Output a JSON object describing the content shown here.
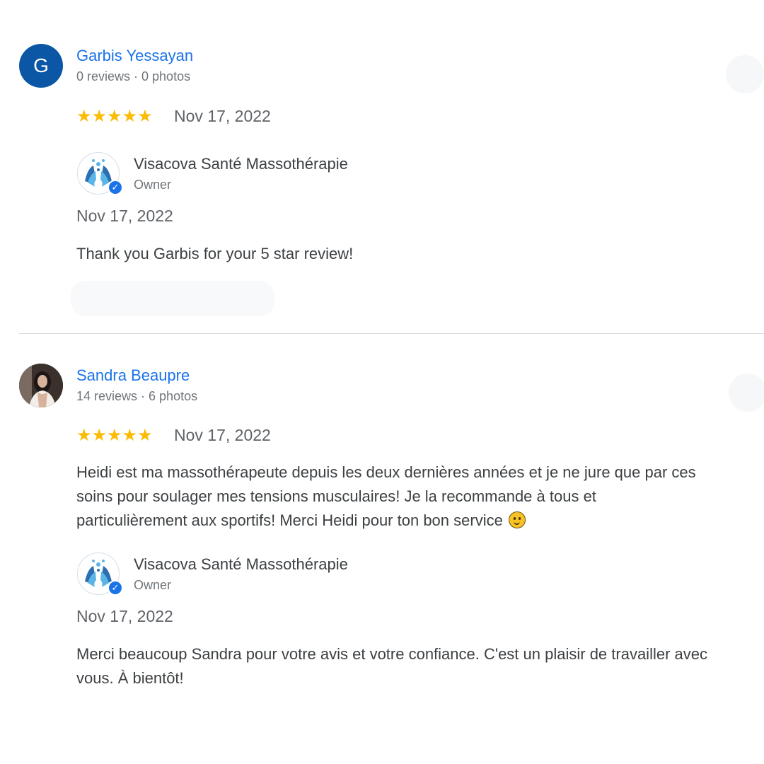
{
  "reviews": [
    {
      "avatar_letter": "G",
      "avatar_color": "#0b57a6",
      "name": "Garbis Yessayan",
      "meta": "0 reviews · 0 photos",
      "stars": "★★★★★",
      "rating": 5,
      "date": "Nov 17, 2022",
      "owner": {
        "name": "Visacova Santé Massothérapie",
        "role": "Owner",
        "date": "Nov 17, 2022",
        "reply": "Thank you Garbis for your 5 star review!"
      }
    },
    {
      "name": "Sandra Beaupre",
      "meta": "14 reviews · 6 photos",
      "stars": "★★★★★",
      "rating": 5,
      "date": "Nov 17, 2022",
      "text_lines": [
        "Heidi est ma massothérapeute depuis les deux dernières années et je ne jure que par ces",
        "soins pour soulager mes tensions musculaires! Je la recommande à tous et",
        "particulièrement aux sportifs! Merci Heidi pour ton bon service"
      ],
      "text_emoji": "slightly-smiling-face-icon",
      "owner": {
        "name": "Visacova Santé Massothérapie",
        "role": "Owner",
        "date": "Nov 17, 2022",
        "reply_lines": [
          "Merci beaucoup Sandra pour votre avis et votre confiance. C'est un plaisir de travailler avec",
          "vous. À bientôt!"
        ]
      }
    }
  ],
  "colors": {
    "link": "#1a73e8",
    "star": "#fbbc04",
    "text": "#3c4043",
    "muted": "#70757a",
    "divider": "#dadce0"
  }
}
